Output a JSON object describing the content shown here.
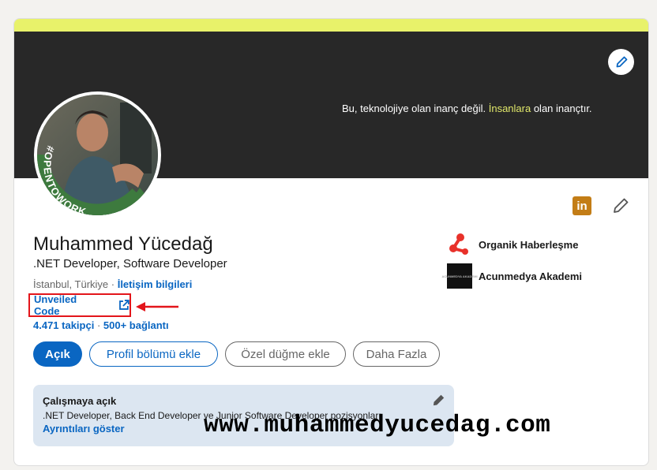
{
  "banner": {
    "tagline_prefix": "Bu, teknolojiye olan inanç değil. ",
    "tagline_highlight": "İnsanlara",
    "tagline_suffix": " olan inançtır."
  },
  "avatar": {
    "badge_text": "#OPENTOWORK"
  },
  "profile": {
    "name": "Muhammed Yücedağ",
    "headline": ".NET Developer, Software Developer",
    "location": "İstanbul, Türkiye",
    "separator": " · ",
    "contact_label": "İletişim bilgileri",
    "website_label": "Unveiled Code",
    "followers": "4.471 takipçi",
    "connections": "500+ bağlantı"
  },
  "actions": {
    "open_label": "Açık",
    "add_section_label": "Profil bölümü ekle",
    "custom_button_label": "Özel düğme ekle",
    "more_label": "Daha Fazla"
  },
  "organizations": [
    {
      "name": "Organik Haberleşme",
      "logo": "organik-logo"
    },
    {
      "name": "Acunmedya Akademi",
      "logo": "acunmedya-logo",
      "logo_text": "ACUNMEDYA AKADEMI"
    }
  ],
  "open_to_work": {
    "title": "Çalışmaya açık",
    "description": ".NET Developer, Back End Developer ve Junior Software Developer pozisyonları",
    "link_label": "Ayrıntıları göster"
  },
  "watermark": "www.muhammedyucedag.com",
  "colors": {
    "brand_blue": "#0a66c2",
    "accent_yellow": "#e8f26a",
    "banner_dark": "#282828",
    "otw_green": "#3d7a3e",
    "linkedin_badge": "#c37d16",
    "highlight_red": "#e3151b"
  }
}
